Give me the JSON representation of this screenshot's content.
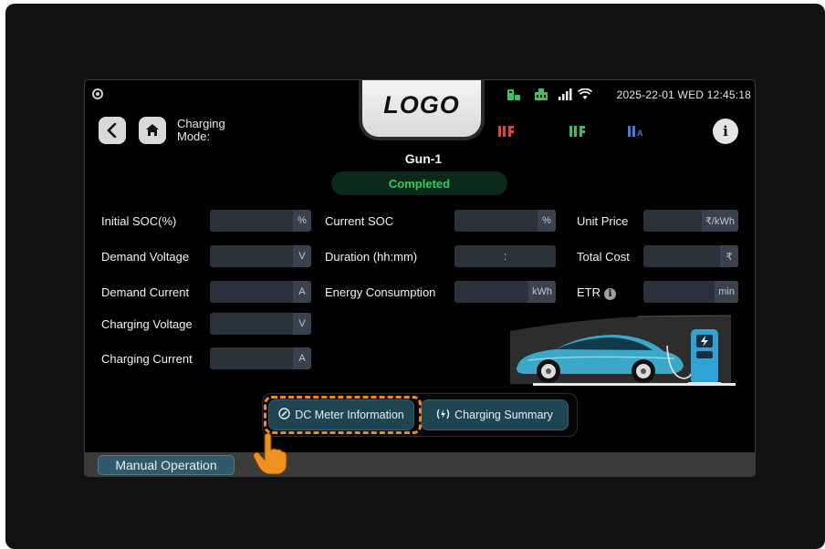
{
  "status_bar": {
    "datetime": "2025-22-01 WED 12:45:18",
    "icons": [
      "camera-icon",
      "charging-station-icon",
      "network-icon",
      "signal-bars-icon",
      "wifi-icon"
    ]
  },
  "logo": {
    "text": "LOGO"
  },
  "header": {
    "mode_label_line1": "Charging",
    "mode_label_line2": "Mode:",
    "connector_icons": [
      {
        "name": "connector-1-icon",
        "color": "#e0452f"
      },
      {
        "name": "connector-2-icon",
        "color": "#2fbf6a"
      },
      {
        "name": "connector-3-icon",
        "color": "#3a7de0",
        "suffix": "A"
      }
    ]
  },
  "gun": {
    "label": "Gun-1",
    "status": "Completed",
    "status_color": "#2ecc63"
  },
  "fields_left": [
    {
      "label": "Initial SOC(%)",
      "value": "",
      "unit": "%"
    },
    {
      "label": "Demand Voltage",
      "value": "",
      "unit": "V"
    },
    {
      "label": "Demand Current",
      "value": "",
      "unit": "A"
    },
    {
      "label": "Charging Voltage",
      "value": "",
      "unit": "V"
    },
    {
      "label": "Charging Current",
      "value": "",
      "unit": "A"
    }
  ],
  "fields_middle": [
    {
      "label": "Current SOC",
      "value": "",
      "unit": "%"
    },
    {
      "label": "Duration (hh:mm)",
      "value": ":",
      "unit": ""
    },
    {
      "label": "Energy Consumption",
      "value": "",
      "unit": "kWh"
    }
  ],
  "fields_right": [
    {
      "label": "Unit Price",
      "value": "",
      "unit": "₹/kWh"
    },
    {
      "label": "Total Cost",
      "value": "",
      "unit": "₹"
    },
    {
      "label": "ETR",
      "value": "",
      "unit": "min"
    }
  ],
  "tabs": [
    {
      "label": "DC Meter Information",
      "icon": "meter-icon",
      "focused": true
    },
    {
      "label": "Charging Summary",
      "icon": "charging-summary-icon",
      "focused": false
    }
  ],
  "footer": {
    "manual_operation_label": "Manual Operation"
  },
  "colors": {
    "accent_teal": "#1f4553",
    "focus_orange": "#f08a1c",
    "background": "#000000"
  }
}
